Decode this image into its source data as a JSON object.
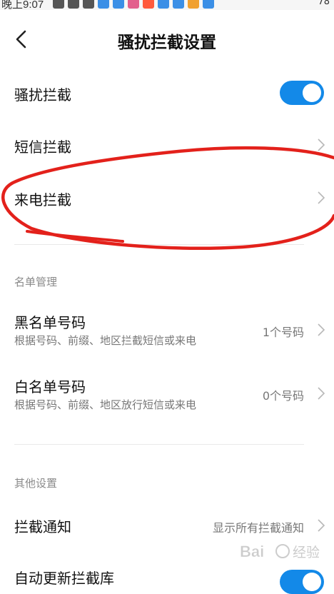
{
  "status_bar": {
    "time": "晚上9:07",
    "right_text": "78"
  },
  "header": {
    "title": "骚扰拦截设置"
  },
  "main": {
    "harassment_block": {
      "label": "骚扰拦截",
      "enabled": true
    },
    "sms_block": {
      "label": "短信拦截"
    },
    "call_block": {
      "label": "来电拦截"
    },
    "list_section": {
      "title": "名单管理",
      "blacklist": {
        "label": "黑名单号码",
        "desc": "根据号码、前缀、地区拦截短信或来电",
        "value": "1个号码"
      },
      "whitelist": {
        "label": "白名单号码",
        "desc": "根据号码、前缀、地区放行短信或来电",
        "value": "0个号码"
      }
    },
    "other_section": {
      "title": "其他设置",
      "notify": {
        "label": "拦截通知",
        "value": "显示所有拦截通知"
      },
      "auto_update": {
        "label": "自动更新拦截库",
        "enabled": true
      }
    }
  },
  "watermark": {
    "text": "Bai 经验"
  },
  "colors": {
    "accent": "#1389e8",
    "annotation": "#e3211b"
  }
}
